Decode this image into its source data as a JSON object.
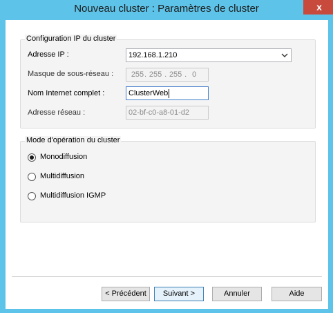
{
  "window": {
    "title": "Nouveau cluster : Paramètres de cluster",
    "close_glyph": "x"
  },
  "ip_config": {
    "group_title": "Configuration IP du cluster",
    "ip_label": "Adresse IP :",
    "ip_value": "192.168.1.210",
    "mask_label": "Masque de sous-réseau :",
    "mask_segments": [
      "255",
      "255",
      "255",
      "0"
    ],
    "fqdn_label": "Nom Internet complet :",
    "fqdn_value": "ClusterWeb",
    "network_label": "Adresse réseau :",
    "network_value": "02-bf-c0-a8-01-d2"
  },
  "operation_mode": {
    "group_title": "Mode d'opération du cluster",
    "options": [
      {
        "label": "Monodiffusion",
        "selected": true
      },
      {
        "label": "Multidiffusion",
        "selected": false
      },
      {
        "label": "Multidiffusion IGMP",
        "selected": false
      }
    ]
  },
  "buttons": {
    "previous": "< Précédent",
    "next": "Suivant >",
    "cancel": "Annuler",
    "help": "Aide"
  },
  "colors": {
    "title_bar": "#5ec3e8",
    "close_button": "#c74a3d"
  }
}
